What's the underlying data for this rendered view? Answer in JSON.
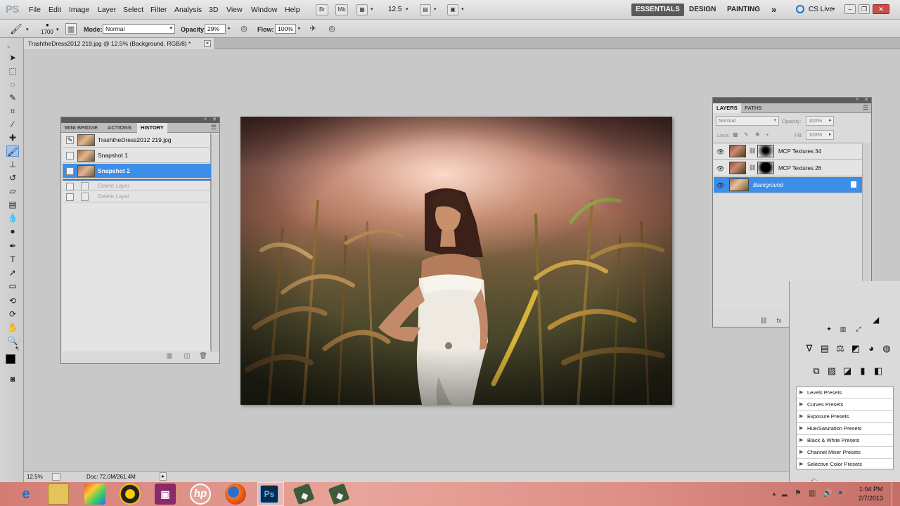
{
  "app": {
    "logo": "PS"
  },
  "menubar": {
    "items": [
      "File",
      "Edit",
      "Image",
      "Layer",
      "Select",
      "Filter",
      "Analysis",
      "3D",
      "View",
      "Window",
      "Help"
    ],
    "zoom": "12.5",
    "workspaces": [
      "ESSENTIALS",
      "DESIGN",
      "PAINTING"
    ],
    "more": "»",
    "cs_live": "CS Live"
  },
  "options": {
    "brush_size": "1700",
    "mode_label": "Mode:",
    "mode_value": "Normal",
    "opacity_label": "Opacity:",
    "opacity_value": "29%",
    "flow_label": "Flow:",
    "flow_value": "100%"
  },
  "document": {
    "tab_title": "TrashtheDress2012 219.jpg @ 12.5% (Background, RGB/8) *",
    "close": "×"
  },
  "history_panel": {
    "tabs": [
      "MINI BRIDGE",
      "ACTIONS",
      "HISTORY"
    ],
    "rows": [
      {
        "label": "TrashtheDress2012 219.jpg",
        "state": "source"
      },
      {
        "label": "Snapshot 1",
        "state": "normal"
      },
      {
        "label": "Snapshot 2",
        "state": "selected"
      },
      {
        "label": "Delete Layer",
        "state": "disabled"
      },
      {
        "label": "Delete Layer",
        "state": "disabled"
      }
    ]
  },
  "layers_panel": {
    "tabs": [
      "LAYERS",
      "PATHS"
    ],
    "blend_mode": "Normal",
    "opacity_label": "Opacity:",
    "opacity_value": "100%",
    "lock_label": "Lock:",
    "fill_label": "Fill:",
    "fill_value": "100%",
    "layers": [
      {
        "name": "MCP Textures 34",
        "selected": false
      },
      {
        "name": "MCP Textures 26",
        "selected": false
      },
      {
        "name": "Background",
        "selected": true
      }
    ]
  },
  "adjustments_panel": {
    "presets": [
      "Levels Presets",
      "Curves Presets",
      "Exposure Presets",
      "Hue/Saturation Presets",
      "Black & White Presets",
      "Channel Mixer Presets",
      "Selective Color Presets"
    ]
  },
  "statusbar": {
    "zoom": "12.5%",
    "doc": "Doc: 72.0M/261.4M"
  },
  "taskbar": {
    "time": "1:04 PM",
    "date": "2/7/2013",
    "photoshop_label": "Ps",
    "hp_label": "hp"
  }
}
